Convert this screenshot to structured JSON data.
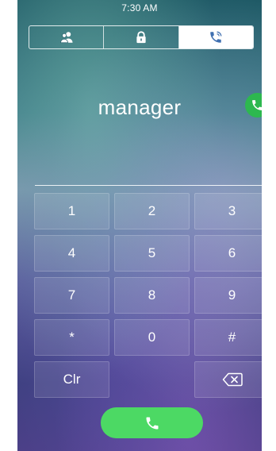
{
  "status_bar": {
    "time": "7:30 AM"
  },
  "tabs": [
    {
      "icon": "contacts-icon",
      "active": false
    },
    {
      "icon": "lock-icon",
      "active": false
    },
    {
      "icon": "phone-ringing-icon",
      "active": true
    }
  ],
  "dial_display": {
    "name": "manager",
    "status_icon": "phone-icon",
    "status_color": "#2db84f"
  },
  "keypad": {
    "keys": [
      {
        "label": "1"
      },
      {
        "label": "2"
      },
      {
        "label": "3"
      },
      {
        "label": "4"
      },
      {
        "label": "5"
      },
      {
        "label": "6"
      },
      {
        "label": "7"
      },
      {
        "label": "8"
      },
      {
        "label": "9"
      },
      {
        "label": "*"
      },
      {
        "label": "0"
      },
      {
        "label": "#"
      }
    ],
    "clear_label": "Clr",
    "backspace_icon": "backspace-icon"
  },
  "call_button": {
    "icon": "phone-icon",
    "color": "#4cd964"
  }
}
